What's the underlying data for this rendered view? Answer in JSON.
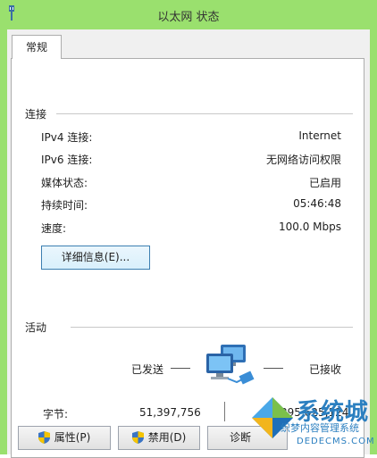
{
  "window": {
    "title": "以太网 状态"
  },
  "tabs": [
    {
      "label": "常规"
    }
  ],
  "connection": {
    "section_label": "连接",
    "rows": [
      {
        "label": "IPv4 连接:",
        "value": "Internet"
      },
      {
        "label": "IPv6 连接:",
        "value": "无网络访问权限"
      },
      {
        "label": "媒体状态:",
        "value": "已启用"
      },
      {
        "label": "持续时间:",
        "value": "05:46:48"
      },
      {
        "label": "速度:",
        "value": "100.0 Mbps"
      }
    ],
    "details_button": "详细信息(E)..."
  },
  "activity": {
    "section_label": "活动",
    "sent_label": "已发送",
    "received_label": "已接收",
    "bytes_label": "字节:",
    "bytes_sent": "51,397,756",
    "bytes_received": "395,625,124"
  },
  "buttons": {
    "properties": "属性(P)",
    "disable": "禁用(D)",
    "diagnose": "诊断"
  },
  "watermark": {
    "main": "系统城",
    "sub": "织梦内容管理系统",
    "url": "DEDECMS.COM"
  },
  "colors": {
    "frame": "#9ae06e",
    "accent": "#3c7fb1"
  }
}
